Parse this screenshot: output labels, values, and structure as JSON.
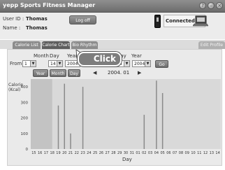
{
  "app": {
    "title": "yepp Sports Fitness Manager"
  },
  "header": {
    "user_id_label": "User ID :",
    "user_id_value": "Thomas",
    "name_label": "Name :",
    "name_value": "Thomas",
    "logoff_label": "Log off",
    "status": "Connected"
  },
  "tabs": [
    {
      "label": "Calorie List",
      "active": false
    },
    {
      "label": "Calorie Chart",
      "active": true
    },
    {
      "label": "Bio Rhythm",
      "active": false
    },
    {
      "label": "Edit Profile",
      "active": false
    }
  ],
  "filter": {
    "month_label": "Month",
    "day_label": "Day",
    "year_label": "Year",
    "from_label": "From",
    "from_month": "1",
    "from_day": "14",
    "from_year": "2004",
    "to_day": "14",
    "to_year": "2004",
    "go_label": "Go",
    "view_year": "Year",
    "view_month": "Month",
    "view_day": "Day",
    "period": "2004. 01"
  },
  "callout": {
    "text": "Click"
  },
  "colors": {
    "chart_bg": "#d9d9d9",
    "highlight_band": "#c3c3c3",
    "bar": "#8a8a8a",
    "titlebar": "#7a7a7a"
  },
  "chart_data": {
    "type": "bar",
    "ylabel": "Calorie (Kcal)",
    "xlabel": "Day",
    "ylim": [
      0,
      450
    ],
    "yticks": [
      0,
      100,
      200,
      300,
      400
    ],
    "categories": [
      "15",
      "16",
      "17",
      "18",
      "19",
      "20",
      "21",
      "22",
      "23",
      "24",
      "25",
      "26",
      "27",
      "28",
      "29",
      "30",
      "31",
      "01",
      "02",
      "03",
      "04",
      "05",
      "06",
      "07",
      "08",
      "09",
      "10",
      "11",
      "12",
      "13",
      "14"
    ],
    "values": [
      0,
      0,
      0,
      0,
      280,
      420,
      100,
      0,
      400,
      0,
      0,
      0,
      0,
      0,
      0,
      0,
      0,
      0,
      220,
      0,
      440,
      360,
      0,
      0,
      0,
      0,
      0,
      0,
      0,
      0,
      0
    ]
  }
}
